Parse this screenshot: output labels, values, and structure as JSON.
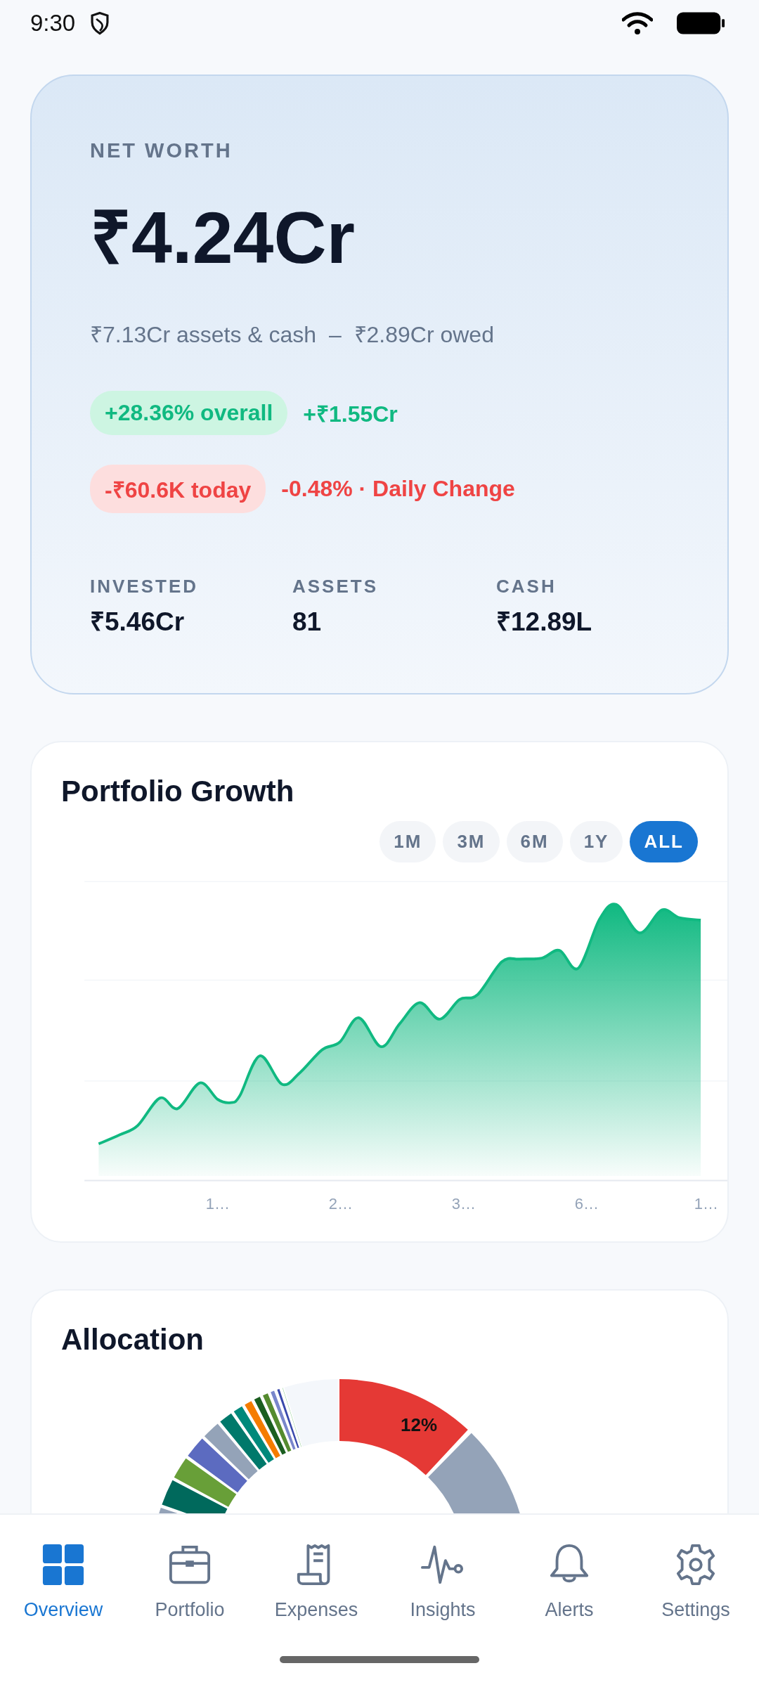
{
  "status_bar": {
    "time": "9:30"
  },
  "net_worth": {
    "label": "NET WORTH",
    "value": "₹4.24Cr",
    "breakdown": "₹7.13Cr assets & cash  –  ₹2.89Cr owed",
    "changes": [
      {
        "kind": "gain",
        "badge": "+28.36% overall",
        "text": "+₹1.55Cr"
      },
      {
        "kind": "loss",
        "badge": "-₹60.6K today",
        "text": "-0.48% · Daily Change"
      }
    ],
    "stats": [
      {
        "label": "INVESTED",
        "value": "₹5.46Cr"
      },
      {
        "label": "ASSETS",
        "value": "81"
      },
      {
        "label": "CASH",
        "value": "₹12.89L"
      }
    ]
  },
  "growth": {
    "title": "Portfolio Growth",
    "ranges": [
      {
        "label": "1M",
        "selected": false
      },
      {
        "label": "3M",
        "selected": false
      },
      {
        "label": "6M",
        "selected": false
      },
      {
        "label": "1Y",
        "selected": false
      },
      {
        "label": "ALL",
        "selected": true
      }
    ],
    "x_labels": [
      "1…",
      "2…",
      "3…",
      "6…",
      "1…"
    ]
  },
  "allocation": {
    "title": "Allocation",
    "slice_label": "12%"
  },
  "nav": [
    {
      "label": "Overview",
      "selected": true
    },
    {
      "label": "Portfolio",
      "selected": false
    },
    {
      "label": "Expenses",
      "selected": false
    },
    {
      "label": "Insights",
      "selected": false
    },
    {
      "label": "Alerts",
      "selected": false
    },
    {
      "label": "Settings",
      "selected": false
    }
  ]
}
